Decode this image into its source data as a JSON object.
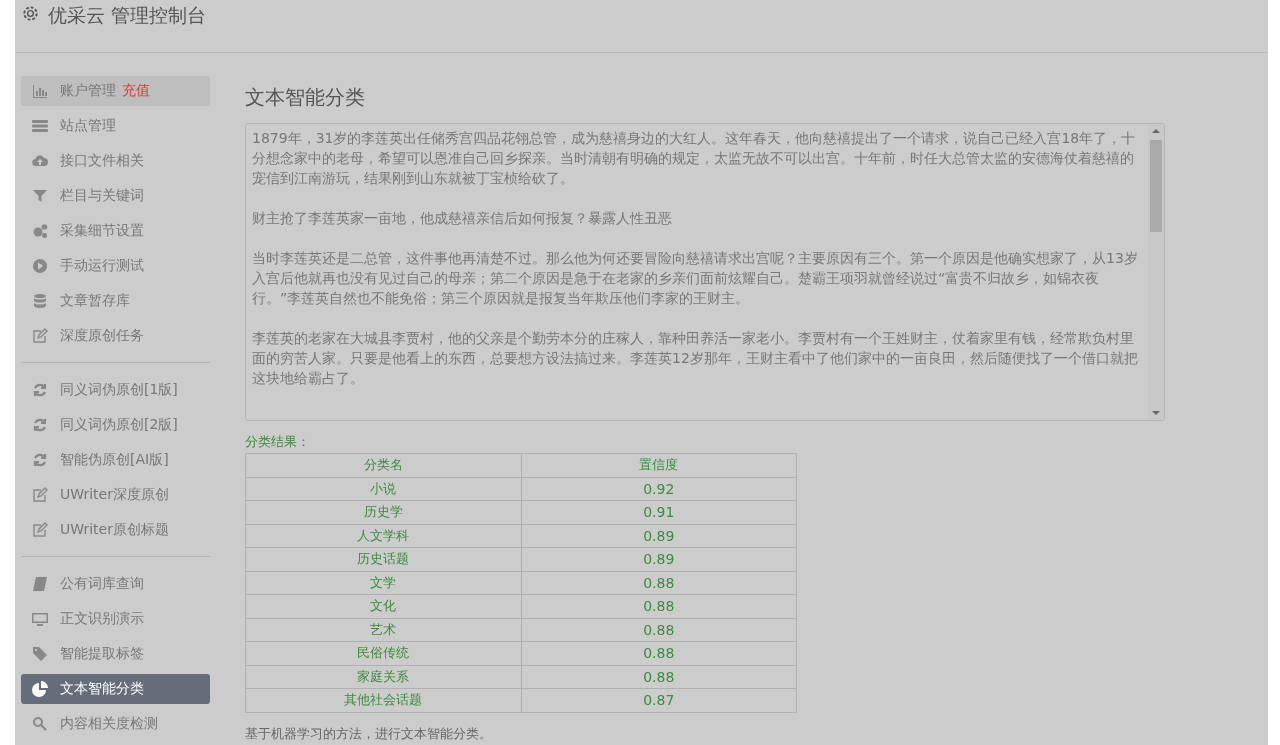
{
  "header": {
    "title": "优采云 管理控制台"
  },
  "sidebar": {
    "groups": [
      {
        "items": [
          {
            "label": "账户管理",
            "badge": "充值",
            "selected": false,
            "hovered": true
          },
          {
            "label": "站点管理",
            "selected": false,
            "hovered": false
          },
          {
            "label": "接口文件相关",
            "selected": false,
            "hovered": false
          },
          {
            "label": "栏目与关键词",
            "selected": false,
            "hovered": false
          },
          {
            "label": "采集细节设置",
            "selected": false,
            "hovered": false
          },
          {
            "label": "手动运行测试",
            "selected": false,
            "hovered": false
          },
          {
            "label": "文章暂存库",
            "selected": false,
            "hovered": false
          },
          {
            "label": "深度原创任务",
            "selected": false,
            "hovered": false
          }
        ]
      },
      {
        "items": [
          {
            "label": "同义词伪原创[1版]",
            "selected": false,
            "hovered": false
          },
          {
            "label": "同义词伪原创[2版]",
            "selected": false,
            "hovered": false
          },
          {
            "label": "智能伪原创[AI版]",
            "selected": false,
            "hovered": false
          },
          {
            "label": "UWriter深度原创",
            "selected": false,
            "hovered": false
          },
          {
            "label": "UWriter原创标题",
            "selected": false,
            "hovered": false
          }
        ]
      },
      {
        "items": [
          {
            "label": "公有词库查询",
            "selected": false,
            "hovered": false
          },
          {
            "label": "正文识别演示",
            "selected": false,
            "hovered": false
          },
          {
            "label": "智能提取标签",
            "selected": false,
            "hovered": false
          },
          {
            "label": "文本智能分类",
            "selected": true,
            "hovered": false
          },
          {
            "label": "内容相关度检测",
            "selected": false,
            "hovered": false
          }
        ]
      }
    ]
  },
  "main": {
    "title": "文本智能分类",
    "text": [
      "1879年，31岁的李莲英出任储秀宫四品花翎总管，成为慈禧身边的大红人。这年春天，他向慈禧提出了一个请求，说自己已经入宫18年了，十分想念家中的老母，希望可以恩准自己回乡探亲。当时清朝有明确的规定，太监无故不可以出宫。十年前，时任大总管太监的安德海仗着慈禧的宠信到江南游玩，结果刚到山东就被丁宝桢给砍了。",
      "财主抢了李莲英家一亩地，他成慈禧亲信后如何报复？暴露人性丑恶",
      "当时李莲英还是二总管，这件事他再清楚不过。那么他为何还要冒险向慈禧请求出宫呢？主要原因有三个。第一个原因是他确实想家了，从13岁入宫后他就再也没有见过自己的母亲；第二个原因是急于在老家的乡亲们面前炫耀自己。楚霸王项羽就曾经说过“富贵不归故乡，如锦衣夜行。”李莲英自然也不能免俗；第三个原因就是报复当年欺压他们李家的王财主。",
      "李莲英的老家在大城县李贾村，他的父亲是个勤劳本分的庄稼人，靠种田养活一家老小。李贾村有一个王姓财主，仗着家里有钱，经常欺负村里面的穷苦人家。只要是他看上的东西，总要想方设法搞过来。李莲英12岁那年，王财主看中了他们家中的一亩良田，然后随便找了一个借口就把这块地给霸占了。"
    ],
    "result_label": "分类结果：",
    "table": {
      "columns": [
        "分类名",
        "置信度"
      ],
      "rows": [
        [
          "小说",
          "0.92"
        ],
        [
          "历史学",
          "0.91"
        ],
        [
          "人文学科",
          "0.89"
        ],
        [
          "历史话题",
          "0.89"
        ],
        [
          "文学",
          "0.88"
        ],
        [
          "文化",
          "0.88"
        ],
        [
          "艺术",
          "0.88"
        ],
        [
          "民俗传统",
          "0.88"
        ],
        [
          "家庭关系",
          "0.88"
        ],
        [
          "其他社会话题",
          "0.87"
        ]
      ]
    },
    "footnote": "基于机器学习的方法，进行文本智能分类。"
  }
}
